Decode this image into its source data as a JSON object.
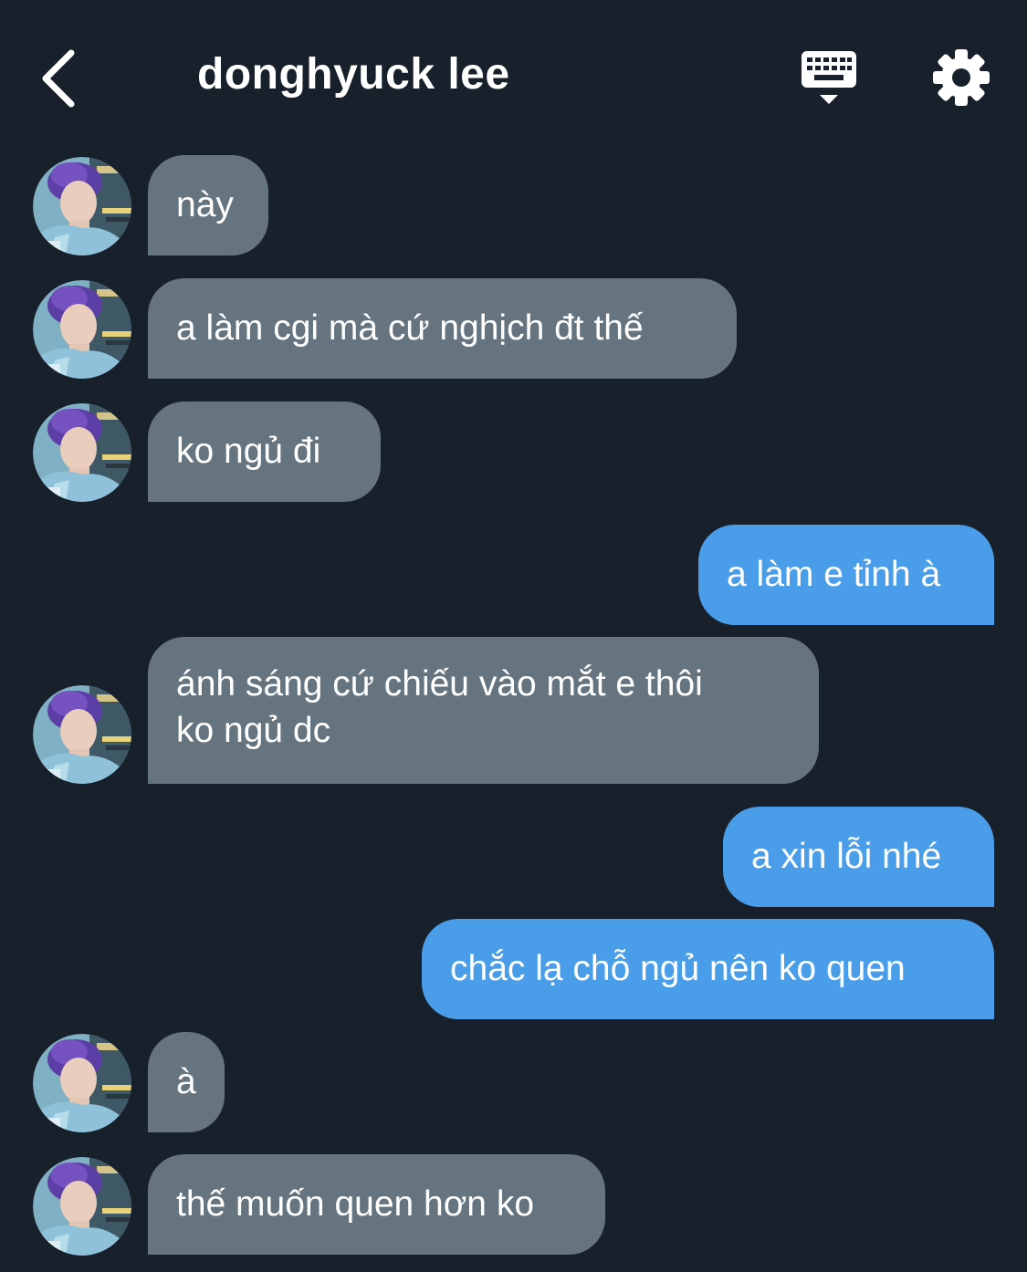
{
  "header": {
    "title": "donghyuck lee"
  },
  "messages": [
    {
      "direction": "in",
      "text": "này"
    },
    {
      "direction": "in",
      "text": "a làm cgi mà cứ nghịch đt thế"
    },
    {
      "direction": "in",
      "text": "ko ngủ đi"
    },
    {
      "direction": "out",
      "text": "a làm e tỉnh à"
    },
    {
      "direction": "in",
      "text": "ánh sáng cứ chiếu vào mắt e thôi\nko ngủ dc"
    },
    {
      "direction": "out",
      "text": "a xin lỗi nhé"
    },
    {
      "direction": "out",
      "text": "chắc lạ chỗ ngủ nên ko quen"
    },
    {
      "direction": "in",
      "text": "à"
    },
    {
      "direction": "in",
      "text": "thế muốn quen hơn ko"
    }
  ],
  "colors": {
    "background": "#18202b",
    "incoming_bubble": "#66747f",
    "outgoing_bubble": "#4a9de8",
    "text": "#ffffff"
  },
  "icons": {
    "back": "chevron-left-icon",
    "keyboard": "keyboard-icon",
    "settings": "gear-icon",
    "avatar": "avatar"
  }
}
